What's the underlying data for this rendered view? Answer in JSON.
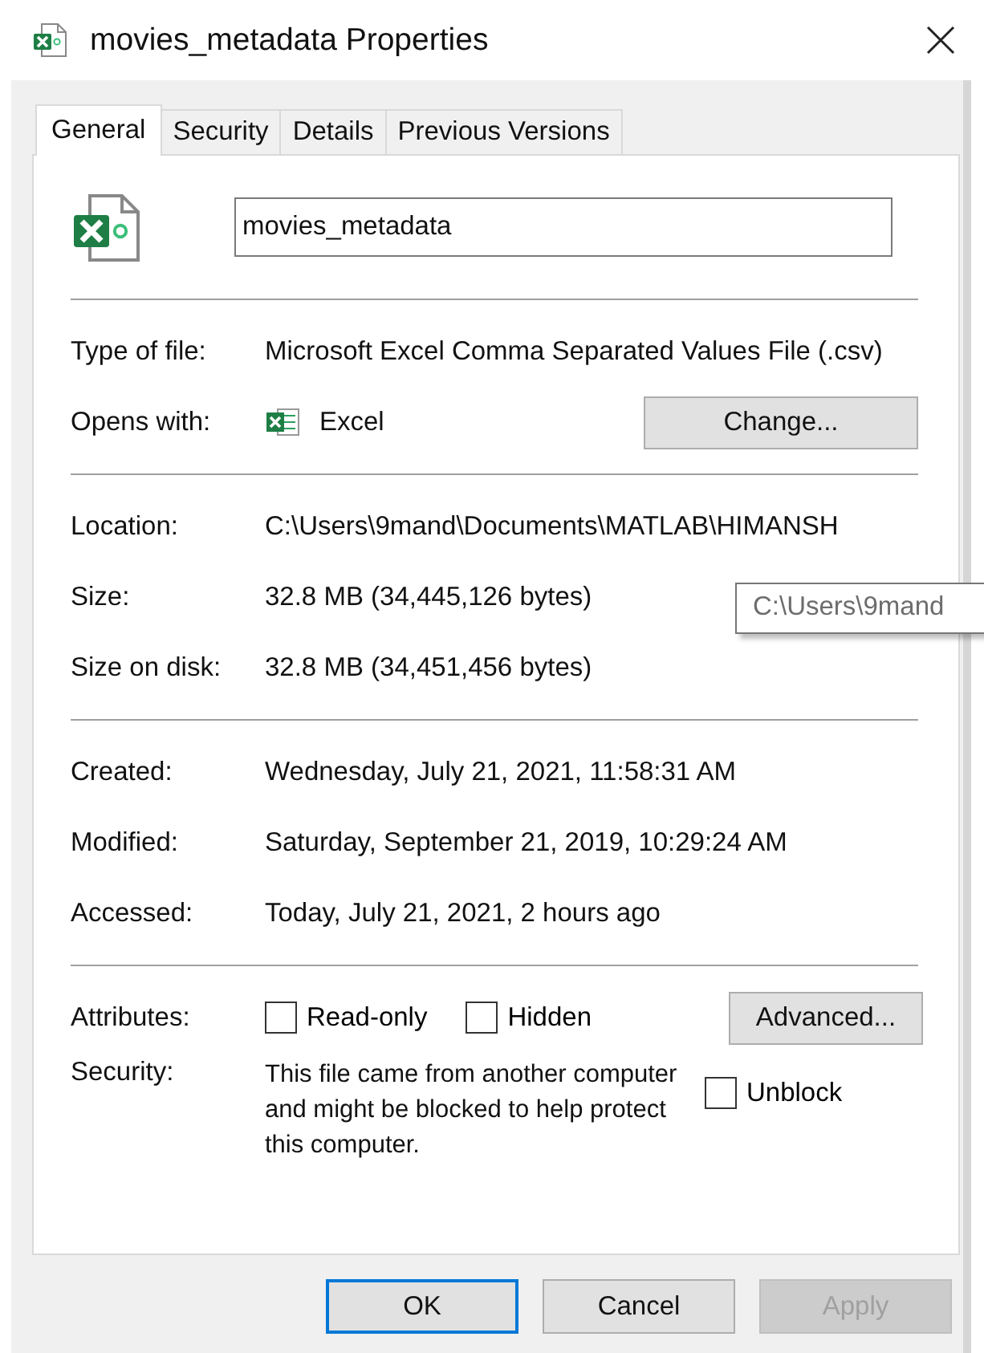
{
  "window": {
    "title": "movies_metadata Properties"
  },
  "tabs": [
    {
      "label": "General",
      "selected": true
    },
    {
      "label": "Security",
      "selected": false
    },
    {
      "label": "Details",
      "selected": false
    },
    {
      "label": "Previous Versions",
      "selected": false
    }
  ],
  "file_name": {
    "value": "movies_metadata"
  },
  "sections": [
    [
      {
        "kind": "text",
        "label": "Type of file:",
        "value": "Microsoft Excel Comma Separated Values File (.csv)"
      },
      {
        "kind": "app",
        "label": "Opens with:",
        "value": "Excel",
        "button": "Change..."
      }
    ],
    [
      {
        "kind": "text",
        "label": "Location:",
        "value": "C:\\Users\\9mand\\Documents\\MATLAB\\HIMANSH"
      },
      {
        "kind": "text",
        "label": "Size:",
        "value": "32.8 MB (34,445,126 bytes)"
      },
      {
        "kind": "text",
        "label": "Size on disk:",
        "value": "32.8 MB (34,451,456 bytes)"
      }
    ],
    [
      {
        "kind": "text",
        "label": "Created:",
        "value": "Wednesday, July 21, 2021, 11:58:31 AM"
      },
      {
        "kind": "text",
        "label": "Modified:",
        "value": "Saturday, September 21, 2019, 10:29:24 AM"
      },
      {
        "kind": "text",
        "label": "Accessed:",
        "value": "Today, July 21, 2021, 2 hours ago"
      }
    ],
    [
      {
        "kind": "checkboxes",
        "label": "Attributes:",
        "checkboxes": [
          {
            "label": "Read-only",
            "checked": false
          },
          {
            "label": "Hidden",
            "checked": false
          }
        ],
        "button": "Advanced..."
      },
      {
        "kind": "security",
        "label": "Security:",
        "value": "This file came from another computer and might be blocked to help protect this computer.",
        "checkbox": {
          "label": "Unblock",
          "checked": false
        }
      }
    ]
  ],
  "tooltip": {
    "text": "C:\\Users\\9mand"
  },
  "buttons": [
    {
      "label": "OK",
      "default": true,
      "disabled": false
    },
    {
      "label": "Cancel",
      "default": false,
      "disabled": false
    },
    {
      "label": "Apply",
      "default": false,
      "disabled": true
    }
  ]
}
